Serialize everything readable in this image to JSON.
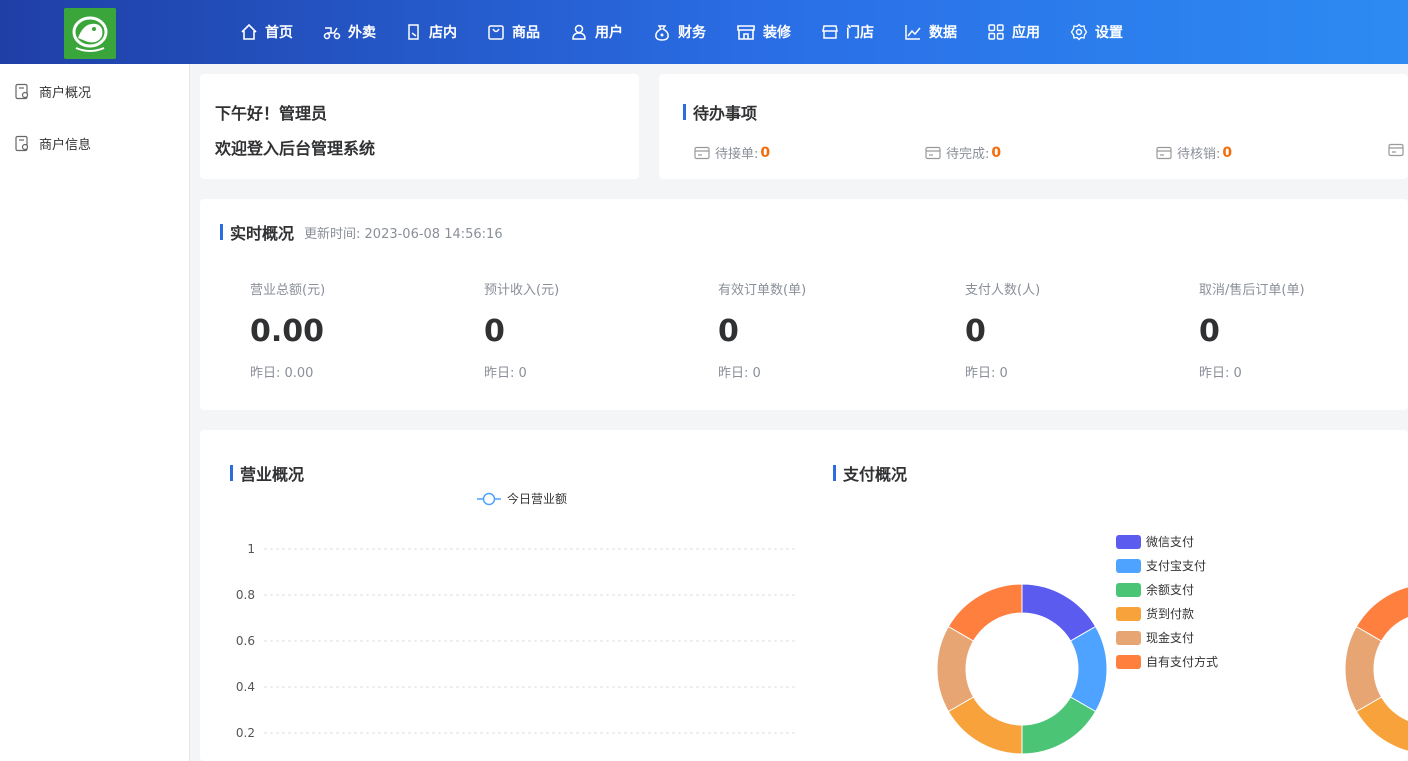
{
  "nav": [
    {
      "label": "首页",
      "icon": "home-icon"
    },
    {
      "label": "外卖",
      "icon": "scooter-icon"
    },
    {
      "label": "店内",
      "icon": "store-inside-icon"
    },
    {
      "label": "商品",
      "icon": "bag-icon"
    },
    {
      "label": "用户",
      "icon": "user-icon"
    },
    {
      "label": "财务",
      "icon": "money-bag-icon"
    },
    {
      "label": "装修",
      "icon": "shop-decor-icon"
    },
    {
      "label": "门店",
      "icon": "storefront-icon"
    },
    {
      "label": "数据",
      "icon": "chart-icon"
    },
    {
      "label": "应用",
      "icon": "apps-icon"
    },
    {
      "label": "设置",
      "icon": "gear-icon"
    }
  ],
  "sidebar": [
    {
      "label": "商户概况",
      "icon": "merchant-overview-icon"
    },
    {
      "label": "商户信息",
      "icon": "merchant-info-icon"
    }
  ],
  "welcome": {
    "line1": "下午好！管理员",
    "line2": "欢迎登入后台管理系统"
  },
  "todo": {
    "title": "待办事项",
    "items": [
      {
        "label": "待接单:",
        "value": "0"
      },
      {
        "label": "待完成:",
        "value": "0"
      },
      {
        "label": "待核销:",
        "value": "0"
      }
    ]
  },
  "realtime": {
    "title": "实时概况",
    "updated": "更新时间: 2023-06-08 14:56:16",
    "stats": [
      {
        "label": "营业总额(元)",
        "value": "0.00",
        "yesterday": "昨日: 0.00"
      },
      {
        "label": "预计收入(元)",
        "value": "0",
        "yesterday": "昨日: 0"
      },
      {
        "label": "有效订单数(单)",
        "value": "0",
        "yesterday": "昨日: 0"
      },
      {
        "label": "支付人数(人)",
        "value": "0",
        "yesterday": "昨日: 0"
      },
      {
        "label": "取消/售后订单(单)",
        "value": "0",
        "yesterday": "昨日: 0"
      }
    ]
  },
  "business": {
    "title": "营业概况"
  },
  "payment": {
    "title": "支付概况"
  },
  "chart_data": [
    {
      "type": "line",
      "series": [
        {
          "name": "今日营业额",
          "values": []
        }
      ],
      "y_ticks": [
        "1",
        "0.8",
        "0.6",
        "0.4",
        "0.2"
      ],
      "ylim": [
        0,
        1
      ],
      "grid": true,
      "legend": "top"
    },
    {
      "type": "pie",
      "categories": [
        "微信支付",
        "支付宝支付",
        "余额支付",
        "货到付款",
        "现金支付",
        "自有支付方式"
      ],
      "values": [
        1,
        1,
        1,
        1,
        1,
        1
      ],
      "colors": [
        "#5b5bf0",
        "#4da3ff",
        "#4cc476",
        "#f8a23c",
        "#e8a574",
        "#ff7f3f"
      ],
      "legend": "right"
    }
  ]
}
